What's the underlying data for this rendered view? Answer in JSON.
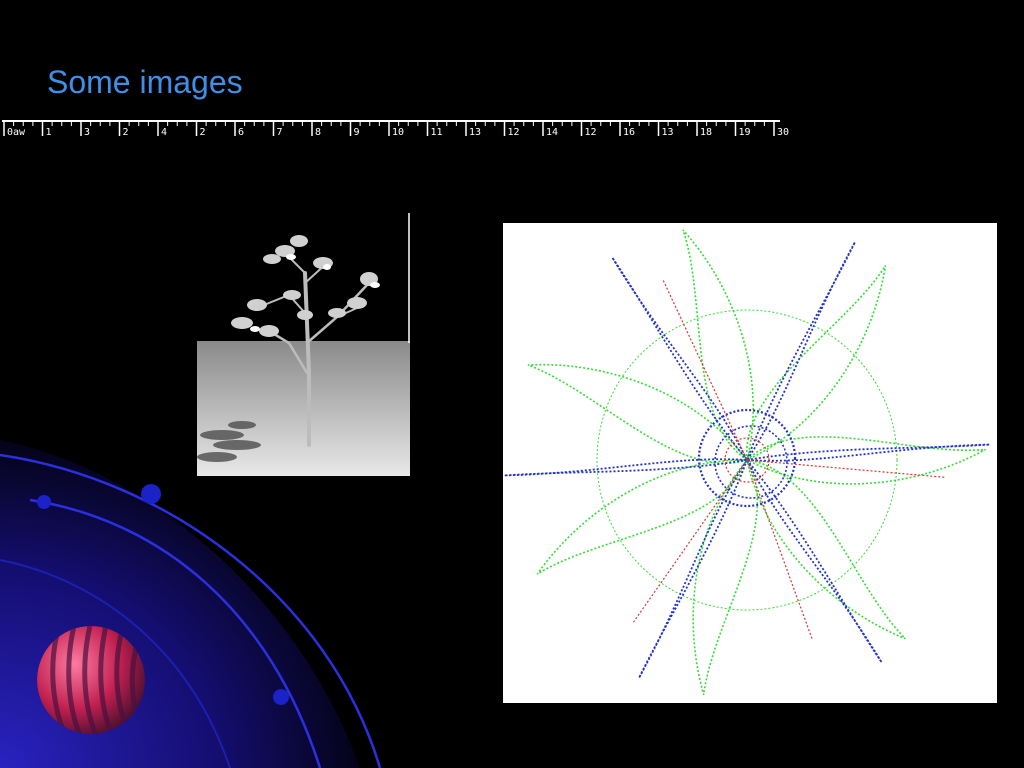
{
  "slide": {
    "title": "Some images"
  },
  "ruler": {
    "labels": [
      "0aw",
      "1",
      "3",
      "2",
      "4",
      "2",
      "6",
      "7",
      "8",
      "9",
      "10",
      "11",
      "13",
      "12",
      "14",
      "12",
      "16",
      "13",
      "18",
      "19",
      "30"
    ]
  },
  "images": {
    "tree": "tree-image",
    "fractal": "fractal-star-image"
  },
  "colors": {
    "background": "#000000",
    "title": "#3f8fe6",
    "ring_blue": "#1a20c8",
    "sphere_red": "#e0306a",
    "fractal_green": "#33dd33",
    "fractal_blue": "#2233cc",
    "fractal_red": "#dd3333"
  }
}
